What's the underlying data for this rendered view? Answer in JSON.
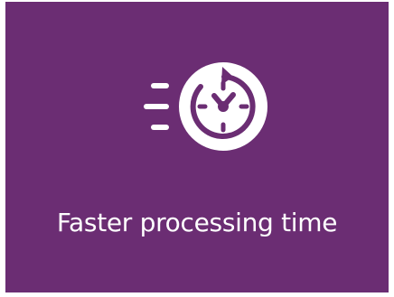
{
  "tile": {
    "background_color": "#6b2d73",
    "icon": "fast-clock-icon",
    "caption": "Faster processing time"
  }
}
